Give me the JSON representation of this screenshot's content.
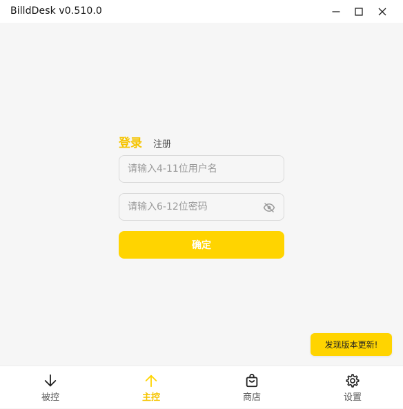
{
  "window": {
    "title": "BilldDesk v0.510.0",
    "controls": [
      "minimize-icon",
      "maximize-icon",
      "close-icon"
    ]
  },
  "auth": {
    "tabs": [
      {
        "label": "登录",
        "active": true
      },
      {
        "label": "注册",
        "active": false
      }
    ],
    "username": {
      "value": "",
      "placeholder": "请输入4-11位用户名"
    },
    "password": {
      "value": "",
      "placeholder": "请输入6-12位密码",
      "toggle_icon": "eye-off-icon"
    },
    "confirm_label": "确定"
  },
  "toast": {
    "text": "发现版本更新!"
  },
  "nav": {
    "items": [
      {
        "label": "被控",
        "icon": "arrow-down-icon",
        "active": false
      },
      {
        "label": "主控",
        "icon": "arrow-up-icon",
        "active": true
      },
      {
        "label": "商店",
        "icon": "shopping-bag-icon",
        "active": false
      },
      {
        "label": "设置",
        "icon": "gear-icon",
        "active": false
      }
    ]
  },
  "colors": {
    "accent": "#ffd400",
    "accent_text": "#f5c400",
    "background": "#f6f6f6",
    "titlebar": "#ffffff"
  }
}
